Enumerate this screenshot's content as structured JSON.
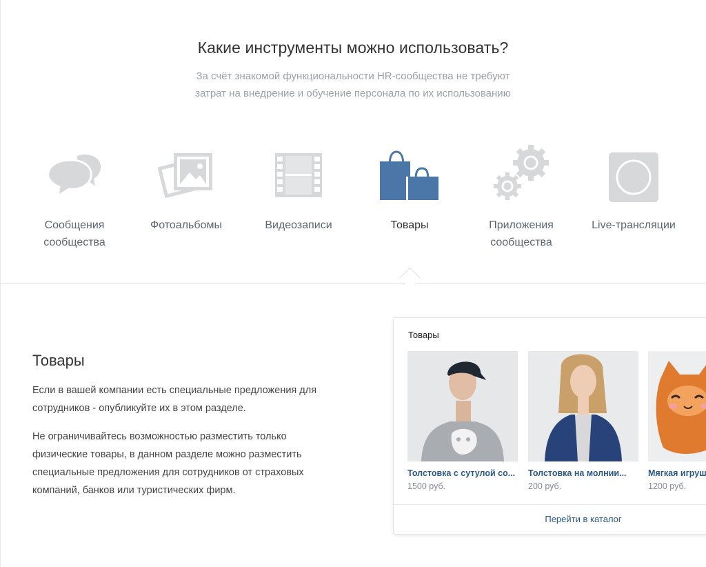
{
  "header": {
    "title": "Какие инструменты можно использовать?",
    "subtitle_line1": "За счёт знакомой функциональности HR-сообщества не требуют",
    "subtitle_line2": "затрат на внедрение и обучение персонала по их использованию"
  },
  "tools": [
    {
      "line1": "Сообщения",
      "line2": "сообщества",
      "icon": "messages-icon"
    },
    {
      "line1": "Фотоальбомы",
      "line2": "",
      "icon": "photo-albums-icon"
    },
    {
      "line1": "Видеозаписи",
      "line2": "",
      "icon": "video-film-icon"
    },
    {
      "line1": "Товары",
      "line2": "",
      "icon": "shopping-bags-icon",
      "active": true
    },
    {
      "line1": "Приложения",
      "line2": "сообщества",
      "icon": "gears-icon"
    },
    {
      "line1": "Live-трансляции",
      "line2": "",
      "icon": "live-circle-icon"
    }
  ],
  "detail": {
    "title": "Товары",
    "p1": "Если в вашей компании есть специальные предложения для сотрудников - опубликуйте их в этом разделе.",
    "p2": "Не ограничивайтесь возможностью разместить только физические товары, в данном разделе можно разместить специальные предложения для сотрудников от страховых компаний, банков или туристических фирм."
  },
  "market": {
    "title": "Товары",
    "products": [
      {
        "name": "Толстовка с сутулой со...",
        "price": "1500 руб."
      },
      {
        "name": "Толстовка на молнии...",
        "price": "200 руб."
      },
      {
        "name": "Мягкая игрушка",
        "price": "1200 руб."
      }
    ],
    "catalog_link": "Перейти в каталог"
  },
  "colors": {
    "accent": "#4a76a8",
    "link": "#2a5885",
    "icon_inactive": "#d7d8d9"
  }
}
